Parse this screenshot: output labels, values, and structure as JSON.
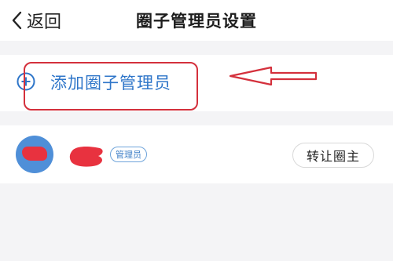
{
  "header": {
    "back_label": "返回",
    "title": "圈子管理员设置"
  },
  "add_admin": {
    "label": "添加圈子管理员",
    "icon": "plus-circle-icon"
  },
  "members": [
    {
      "role_badge": "管理员",
      "action_label": "转让圈主"
    }
  ],
  "colors": {
    "accent": "#2f76c9",
    "annotation": "#d4303c",
    "avatar_bg": "#4f8fd8",
    "page_bg": "#f4f4f6"
  }
}
